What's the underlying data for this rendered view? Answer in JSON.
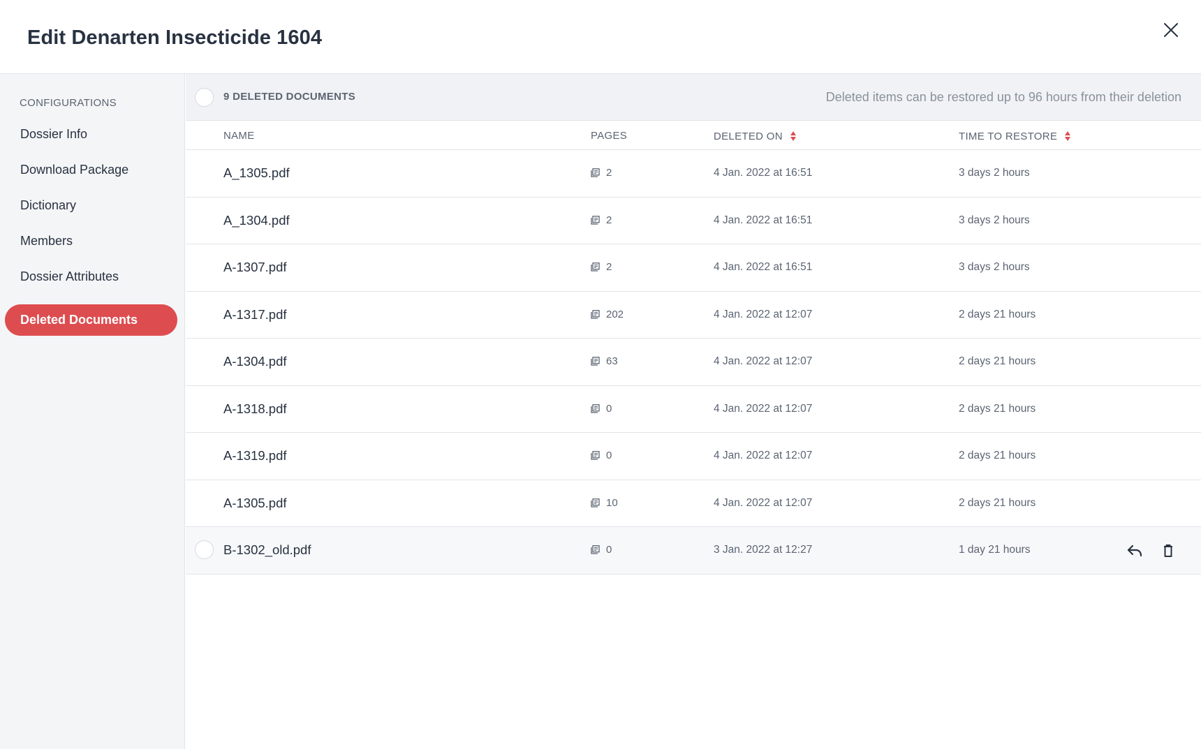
{
  "header": {
    "title": "Edit Denarten Insecticide 1604"
  },
  "sidebar": {
    "heading": "CONFIGURATIONS",
    "items": [
      {
        "label": "Dossier Info",
        "active": false
      },
      {
        "label": "Download Package",
        "active": false
      },
      {
        "label": "Dictionary",
        "active": false
      },
      {
        "label": "Members",
        "active": false
      },
      {
        "label": "Dossier Attributes",
        "active": false
      },
      {
        "label": "Deleted Documents",
        "active": true
      }
    ]
  },
  "bulk": {
    "count_label": "9 DELETED DOCUMENTS",
    "info": "Deleted items can be restored up to 96 hours from their deletion"
  },
  "table": {
    "columns": {
      "name": "NAME",
      "pages": "PAGES",
      "deleted_on": "DELETED ON",
      "time_to_restore": "TIME TO RESTORE"
    },
    "rows": [
      {
        "name": "A_1305.pdf",
        "pages": "2",
        "deleted_on": "4 Jan. 2022 at 16:51",
        "time_to_restore": "3 days 2 hours"
      },
      {
        "name": "A_1304.pdf",
        "pages": "2",
        "deleted_on": "4 Jan. 2022 at 16:51",
        "time_to_restore": "3 days 2 hours"
      },
      {
        "name": "A-1307.pdf",
        "pages": "2",
        "deleted_on": "4 Jan. 2022 at 16:51",
        "time_to_restore": "3 days 2 hours"
      },
      {
        "name": "A-1317.pdf",
        "pages": "202",
        "deleted_on": "4 Jan. 2022 at 12:07",
        "time_to_restore": "2 days 21 hours"
      },
      {
        "name": "A-1304.pdf",
        "pages": "63",
        "deleted_on": "4 Jan. 2022 at 12:07",
        "time_to_restore": "2 days 21 hours"
      },
      {
        "name": "A-1318.pdf",
        "pages": "0",
        "deleted_on": "4 Jan. 2022 at 12:07",
        "time_to_restore": "2 days 21 hours"
      },
      {
        "name": "A-1319.pdf",
        "pages": "0",
        "deleted_on": "4 Jan. 2022 at 12:07",
        "time_to_restore": "2 days 21 hours"
      },
      {
        "name": "A-1305.pdf",
        "pages": "10",
        "deleted_on": "4 Jan. 2022 at 12:07",
        "time_to_restore": "2 days 21 hours"
      },
      {
        "name": "B-1302_old.pdf",
        "pages": "0",
        "deleted_on": "3 Jan. 2022 at 12:27",
        "time_to_restore": "1 day 21 hours"
      }
    ]
  },
  "icons": {
    "close": "close-icon",
    "pages": "pages-icon",
    "restore": "restore-icon",
    "delete": "trash-icon",
    "sort": "sort-icon"
  },
  "colors": {
    "accent": "#dd4d50",
    "sidebar_bg": "#f4f5f7",
    "bar_bg": "#f0f2f5"
  }
}
